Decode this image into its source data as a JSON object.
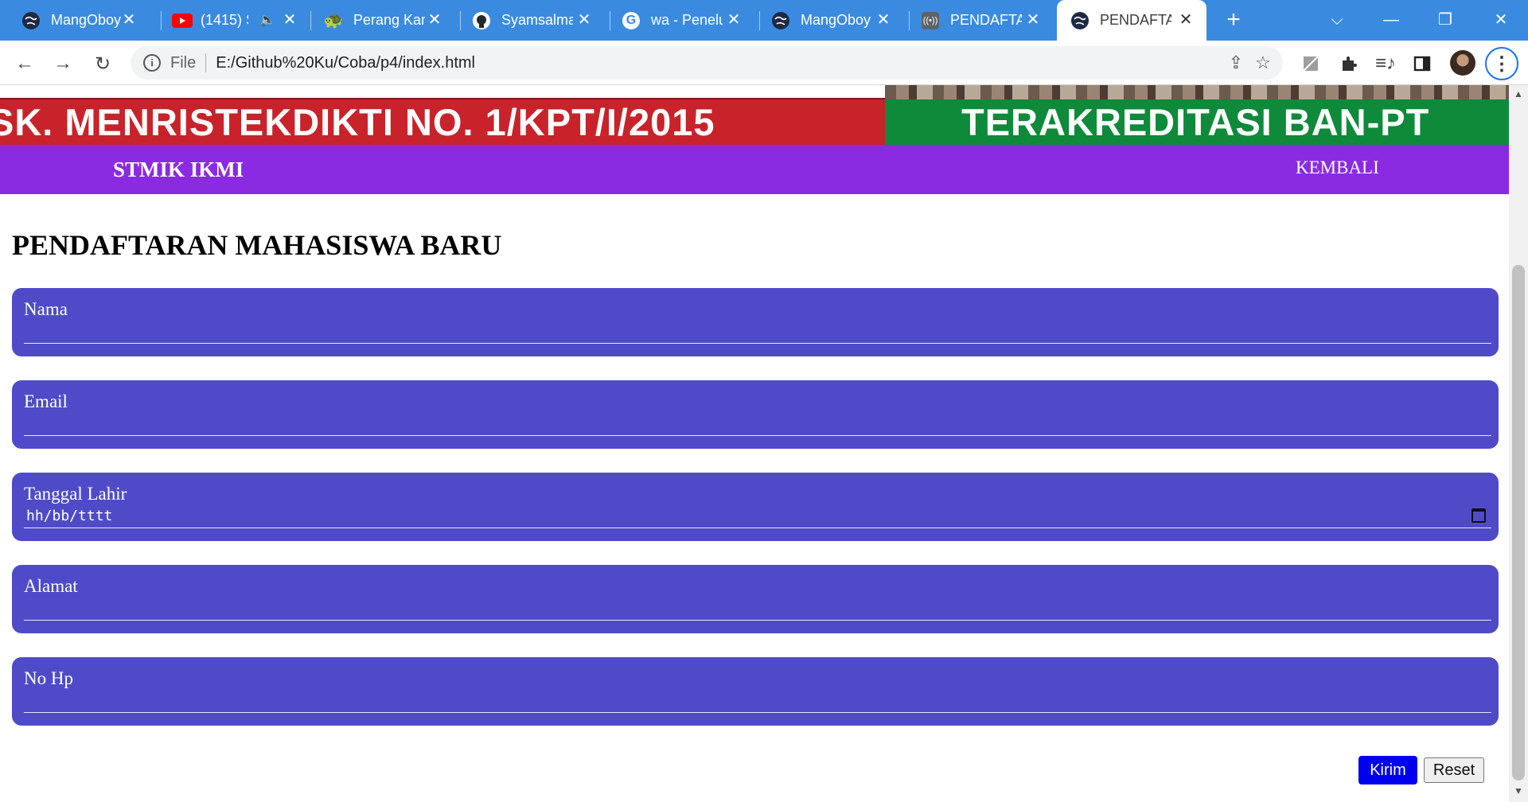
{
  "browser": {
    "tabs": [
      {
        "title": "MangOboy",
        "icon": "globe-icon",
        "muted": false
      },
      {
        "title": "(1415) S",
        "icon": "youtube-icon",
        "muted": true
      },
      {
        "title": "Perang Kam",
        "icon": "game-icon",
        "muted": false
      },
      {
        "title": "Syamsalma",
        "icon": "github-icon",
        "muted": false
      },
      {
        "title": "wa - Penelu",
        "icon": "google-icon",
        "muted": false
      },
      {
        "title": "MangOboy",
        "icon": "globe-icon",
        "muted": false
      },
      {
        "title": "PENDAFTAI",
        "icon": "broadcast-icon",
        "muted": false
      },
      {
        "title": "PENDAFTAI",
        "icon": "globe-icon",
        "muted": false
      }
    ],
    "active_tab_index": 7,
    "address": {
      "scheme_label": "File",
      "url": "E:/Github%20Ku/Coba/p4/index.html"
    }
  },
  "page": {
    "banner": {
      "left_text": "SK. MENRISTEKDIKTI NO. 1/KPT/I/2015",
      "right_text": "TERAKREDITASI BAN-PT",
      "left_color": "#c8232a",
      "right_color": "#0e8a3a"
    },
    "nav": {
      "brand": "STMIK IKMI",
      "back_link": "KEMBALI",
      "color": "#8a2be2"
    },
    "title": "PENDAFTARAN MAHASISWA BARU",
    "form": {
      "field_color": "#4f4bc8",
      "fields": [
        {
          "label": "Nama",
          "type": "text",
          "value": ""
        },
        {
          "label": "Email",
          "type": "email",
          "value": ""
        },
        {
          "label": "Tanggal Lahir",
          "type": "date",
          "placeholder": "hh/bb/tttt"
        },
        {
          "label": "Alamat",
          "type": "text",
          "value": ""
        },
        {
          "label": "No Hp",
          "type": "tel",
          "value": ""
        }
      ],
      "submit_label": "Kirim",
      "reset_label": "Reset",
      "submit_color": "#0000f0"
    }
  }
}
